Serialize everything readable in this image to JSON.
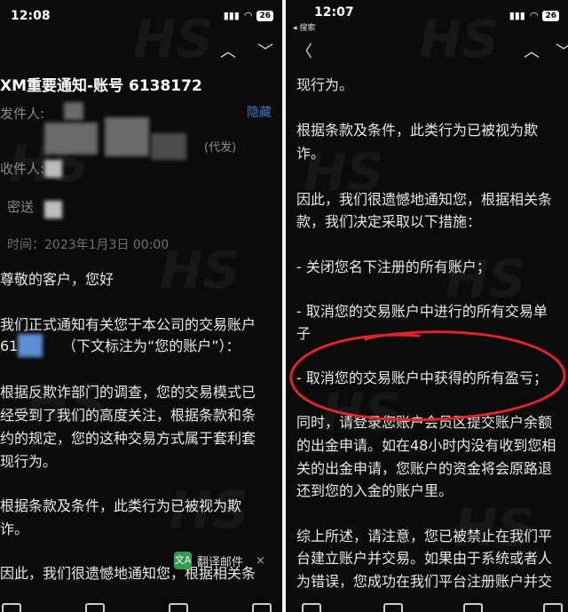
{
  "left": {
    "status": {
      "time": "12:08",
      "battery": "26"
    },
    "subject": "XM重要通知-账号 6138172",
    "hide_link": "隐藏",
    "labels": {
      "from": "发件人:",
      "on_behalf": "(代发)",
      "to": "收件人:",
      "cc": "密送",
      "time": "时间：2023年1月3日 00:00"
    },
    "body": [
      "尊敬的客户，您好",
      "我们正式通知有关您于本公司的交易账户",
      "（下文标注为“您的账户”）：",
      "根据反欺诈部门的调查，您的交易模式已",
      "经受到了我们的高度关注，根据条款和条",
      "约的规定，您的这种交易方式属于套利套",
      "现行为。",
      "根据条款及条件，此类行为已被视为欺",
      "诈。",
      "因此，我们很遗憾地通知您，根据相关条"
    ],
    "account_prefix": "61",
    "translate": {
      "label": "翻译邮件",
      "icon": "文A",
      "close": "×"
    }
  },
  "right": {
    "status": {
      "time": "12:07",
      "back_app": "◂ 搜索",
      "battery": "26"
    },
    "body": [
      "现行为。",
      "根据条款及条件，此类行为已被视为欺",
      "诈。",
      "因此，我们很遗憾地通知您，根据相关条",
      "款，我们决定采取以下措施：",
      "- 关闭您名下注册的所有账户；",
      "- 取消您的交易账户中进行的所有交易单",
      "子",
      "- 取消您的交易账户中获得的所有盈亏；",
      "同时，请登录您账户会员区提交账户余额",
      "的出金申请。如在48小时内没有收到您相",
      "关的出金申请，您账户的资金将会原路退",
      "还到您的入金的账户里。",
      "综上所述，请注意，您已被禁止在我们平",
      "台建立账户并交易。如果由于系统或者人",
      "为错误，您成功在我们平台注册账户并交"
    ]
  },
  "icons": {
    "back": "back-chevron-icon",
    "up": "chevron-up-icon",
    "down": "chevron-down-icon",
    "signal": "signal-icon",
    "wifi": "wifi-icon"
  },
  "colors": {
    "annotation": "#e0242a",
    "link": "#3b77d9",
    "translate_icon": "#2f9e4b"
  },
  "watermark": "HS"
}
